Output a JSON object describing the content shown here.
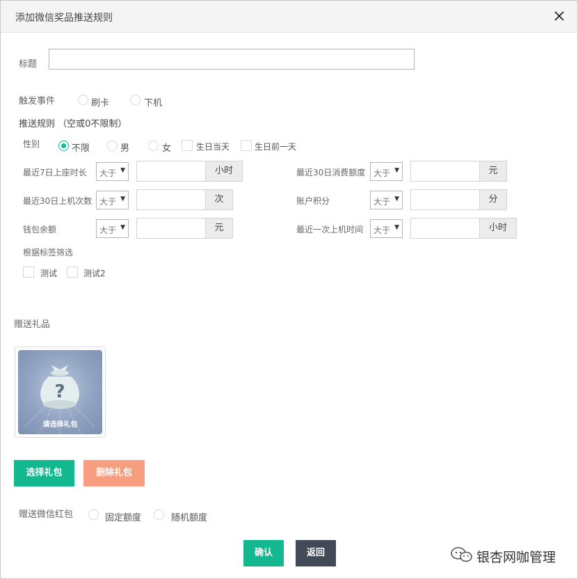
{
  "dialog": {
    "title": "添加微信奖品推送规则",
    "close_label": "×"
  },
  "form": {
    "title_label": "标题",
    "title_value": "",
    "trigger_label": "触发事件",
    "trigger_options": [
      "刷卡",
      "下机"
    ],
    "rules_heading": "推送规则 （空或0不限制）",
    "gender_label": "性别",
    "gender_options": [
      "不限",
      "男",
      "女"
    ],
    "gender_selected": "不限",
    "birthday_options": [
      "生日当天",
      "生日前一天"
    ],
    "rows": [
      {
        "label": "最近7日上座时长",
        "op": "大于",
        "value": "",
        "unit": "小时"
      },
      {
        "label": "最近30日上机次数",
        "op": "大于",
        "value": "",
        "unit": "次"
      },
      {
        "label": "钱包余额",
        "op": "大于",
        "value": "",
        "unit": "元"
      },
      {
        "label": "最近30日消费额度",
        "op": "大于",
        "value": "",
        "unit": "元"
      },
      {
        "label": "账户积分",
        "op": "大于",
        "value": "",
        "unit": "分"
      },
      {
        "label": "最近一次上机时间",
        "op": "大于",
        "value": "",
        "unit": "小时"
      }
    ],
    "tag_filter_label": "根据标签筛选",
    "tags": [
      "测试",
      "测试2"
    ]
  },
  "gift": {
    "heading": "赠送礼品",
    "placeholder_label": "请选择礼包",
    "select_button": "选择礼包",
    "delete_button": "删除礼包"
  },
  "redpacket": {
    "label": "赠送微信红包",
    "options": [
      "固定额度",
      "随机额度"
    ]
  },
  "footer": {
    "confirm": "确认",
    "back": "返回"
  },
  "watermark": {
    "text": "银杏网咖管理"
  },
  "colors": {
    "accent": "#13b88f",
    "danger": "#f89e80",
    "dark_button": "#434a57"
  }
}
